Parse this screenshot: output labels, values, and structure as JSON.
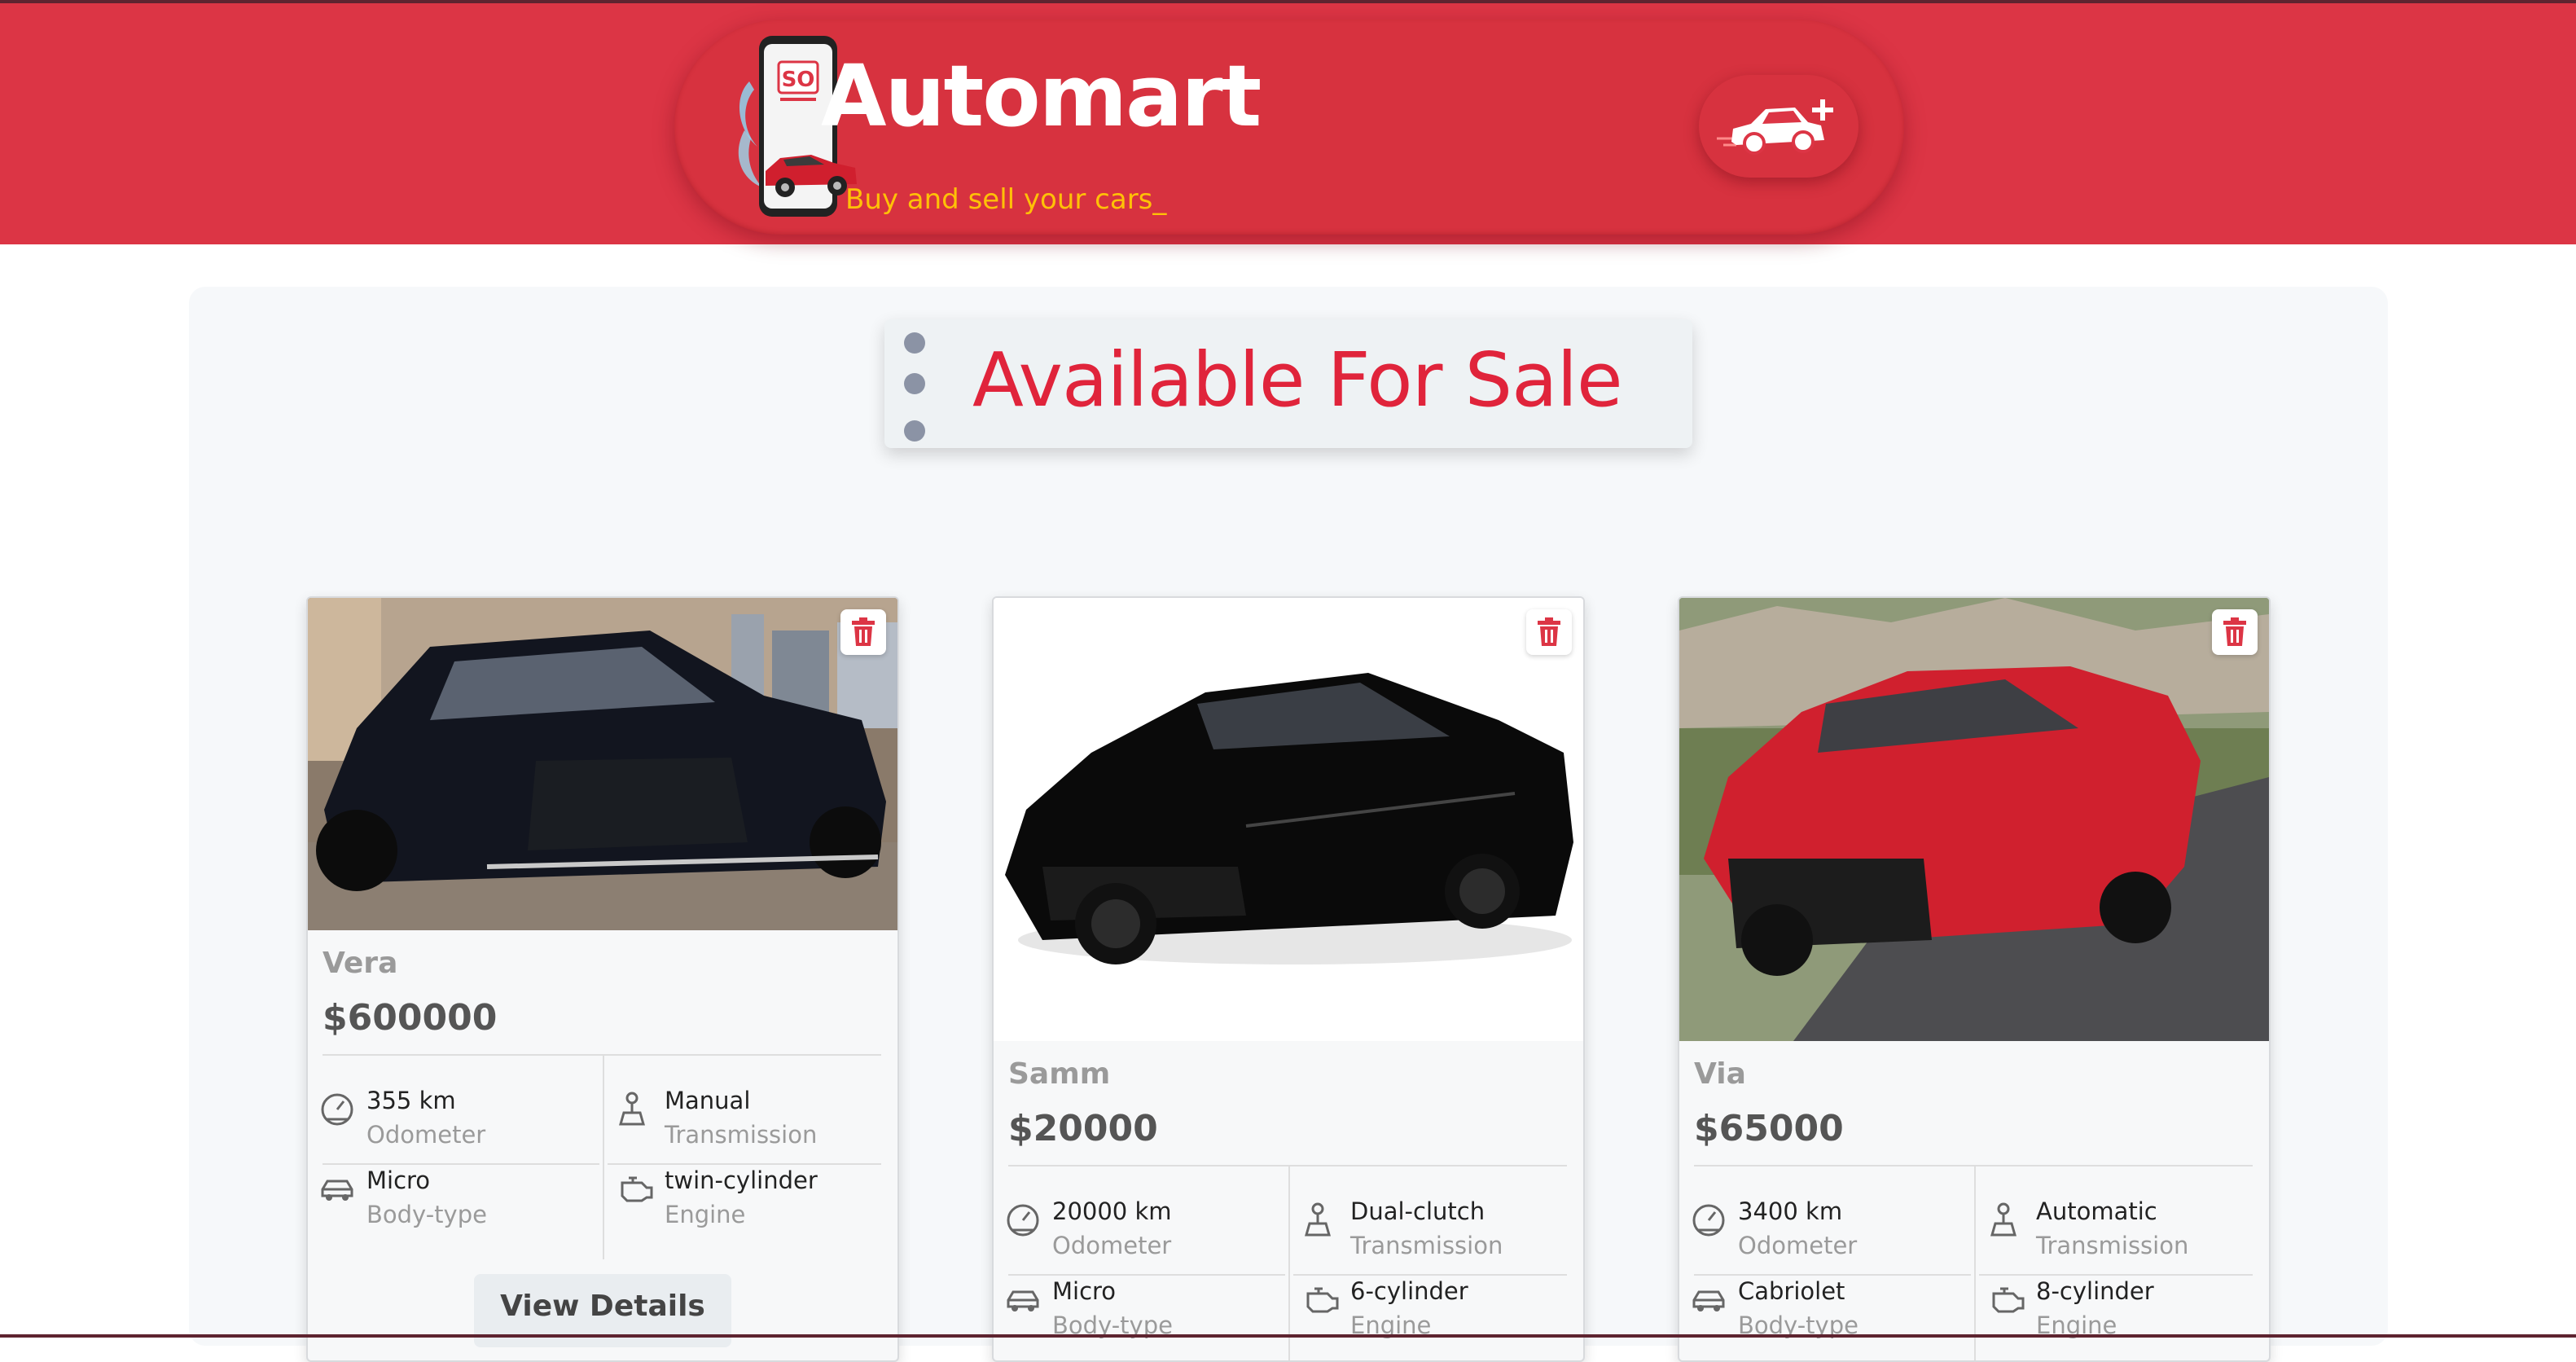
{
  "header": {
    "brand_title": "Automart",
    "tagline": "Buy and sell your cars_",
    "logo_badge": "SO",
    "add_car_icon": "add-car-icon",
    "colors": {
      "header_bg": "#dc3545",
      "tagline": "#ffc107",
      "title": "#ffffff"
    }
  },
  "section": {
    "title": "Available For Sale",
    "title_color": "#e0243b"
  },
  "labels": {
    "odometer": "Odometer",
    "transmission": "Transmission",
    "body_type": "Body-type",
    "engine": "Engine",
    "view_details": "View Details"
  },
  "icons": {
    "delete": "trash-icon",
    "odometer": "speedometer-icon",
    "transmission": "gear-shift-icon",
    "body_type": "car-icon",
    "engine": "engine-icon"
  },
  "cars": [
    {
      "name": "Vera",
      "price": "$600000",
      "odometer": "355 km",
      "transmission": "Manual",
      "body_type": "Micro",
      "engine": "twin-cylinder",
      "color": "#12151f"
    },
    {
      "name": "Samm",
      "price": "$20000",
      "odometer": "20000 km",
      "transmission": "Dual-clutch",
      "body_type": "Micro",
      "engine": "6-cylinder",
      "color": "#0a0a0a"
    },
    {
      "name": "Via",
      "price": "$65000",
      "odometer": "3400 km",
      "transmission": "Automatic",
      "body_type": "Cabriolet",
      "engine": "8-cylinder",
      "color": "#d0202e"
    }
  ]
}
